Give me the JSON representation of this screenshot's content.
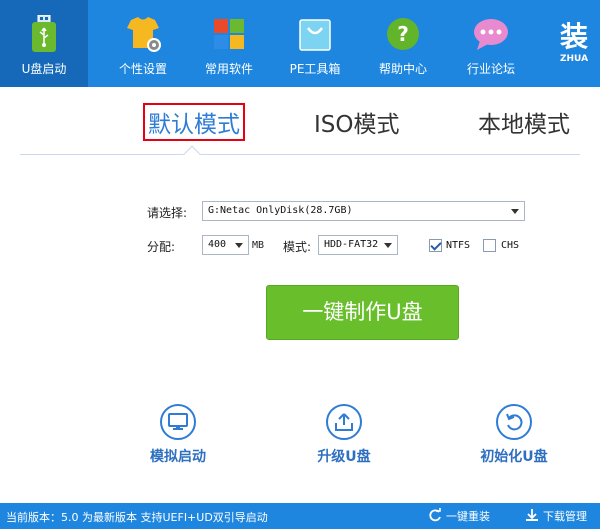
{
  "toolbar": {
    "items": [
      {
        "label": "U盘启动",
        "icon": "usb-drive-icon"
      },
      {
        "label": "个性设置",
        "icon": "shirt-gear-icon"
      },
      {
        "label": "常用软件",
        "icon": "tiles-icon"
      },
      {
        "label": "PE工具箱",
        "icon": "toolbox-bag-icon"
      },
      {
        "label": "帮助中心",
        "icon": "help-icon"
      },
      {
        "label": "行业论坛",
        "icon": "chat-bubble-icon"
      }
    ],
    "brand_cn": "装",
    "brand_en": "ZHUA"
  },
  "tabs": [
    {
      "label": "默认模式",
      "active": true
    },
    {
      "label": "ISO模式",
      "active": false
    },
    {
      "label": "本地模式",
      "active": false
    }
  ],
  "form": {
    "select_label": "请选择:",
    "disk_value": "G:Netac OnlyDisk(28.7GB)",
    "alloc_label": "分配:",
    "alloc_value": "400",
    "alloc_unit": "MB",
    "mode_label": "模式:",
    "mode_value": "HDD-FAT32",
    "ntfs_label": "NTFS",
    "ntfs_checked": true,
    "chs_label": "CHS",
    "chs_checked": false
  },
  "main_button": "一键制作U盘",
  "actions": [
    {
      "label": "模拟启动",
      "icon": "monitor-icon"
    },
    {
      "label": "升级U盘",
      "icon": "upload-icon"
    },
    {
      "label": "初始化U盘",
      "icon": "reset-icon"
    }
  ],
  "status": {
    "text": "当前版本：5.0 为最新版本 支持UEFI+UD双引导启动",
    "reinstall_label": "一键重装",
    "download_label": "下载管理"
  },
  "colors": {
    "brand_blue": "#1f86df",
    "active_tool": "#1669b9",
    "green_button": "#69be2c",
    "tab_highlight": "#e60012"
  }
}
